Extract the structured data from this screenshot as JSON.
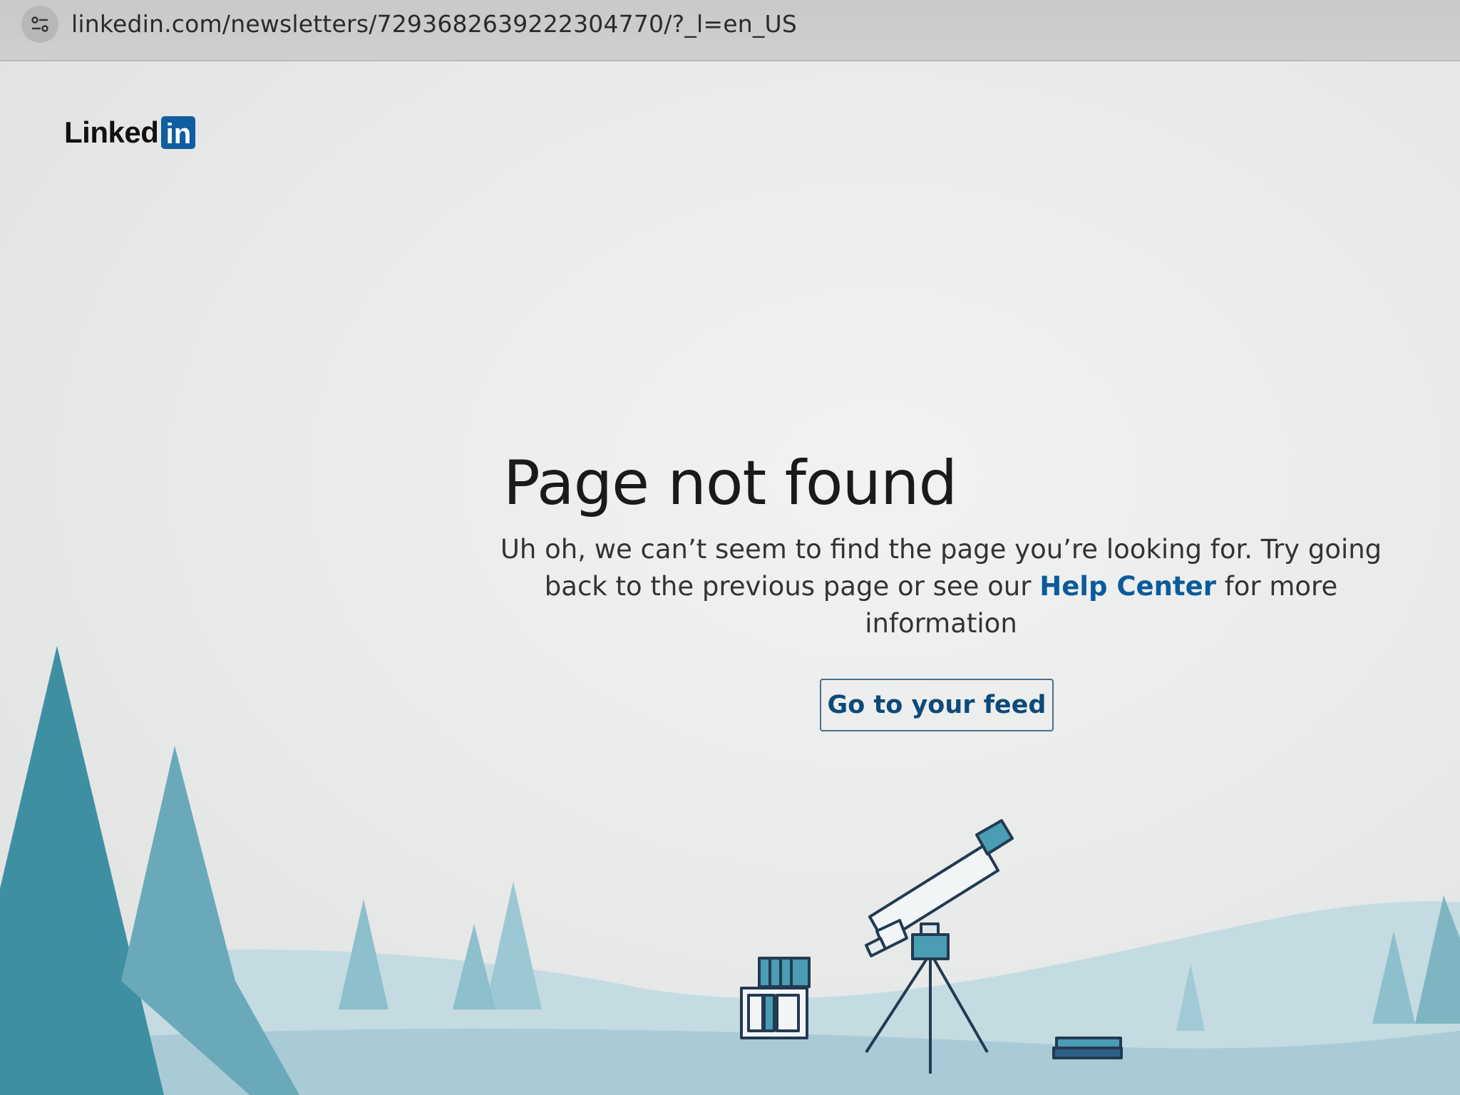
{
  "browser": {
    "url": "linkedin.com/newsletters/7293682639222304770/?_l=en_US",
    "site_info_icon": "tune-icon"
  },
  "header": {
    "logo_text": "Linked",
    "logo_badge": "in"
  },
  "main": {
    "title": "Page not found",
    "message_before": "Uh oh, we can’t seem to find the page you’re looking for. Try going back to the previous page or see our",
    "help_link": "Help Center",
    "message_after": "for more information",
    "feed_button": "Go to your feed"
  },
  "illustration": {
    "icons": [
      "pine-tree-icon",
      "telescope-icon",
      "bookshelf-icon",
      "books-icon"
    ]
  },
  "colors": {
    "brand": "#0f5ea1",
    "link": "#0b5b9c",
    "tree_dark": "#3f8fa3",
    "tree_light": "#7fb5c3",
    "ground": "#b7d4dd"
  }
}
